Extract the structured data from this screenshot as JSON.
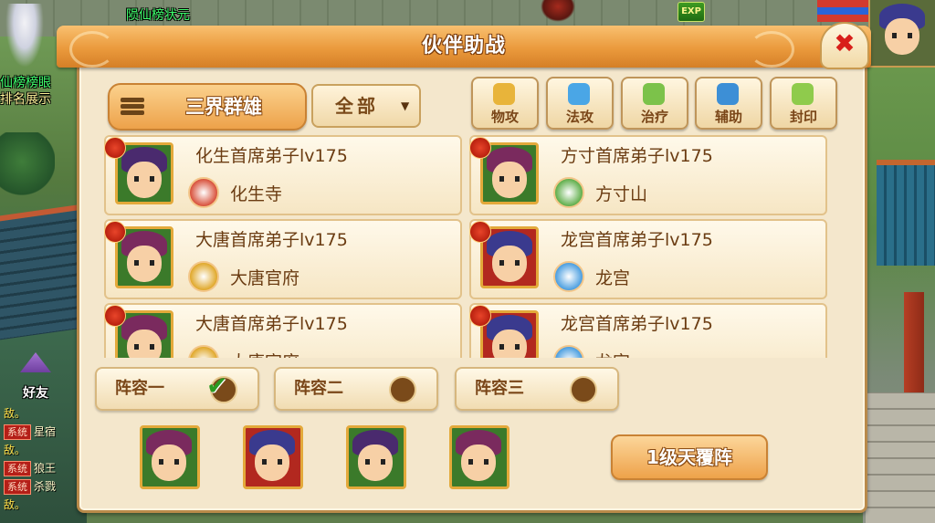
{
  "scene": {
    "top_name": "陨仙榜状元",
    "left_label_1": "仙榜榜眼",
    "left_label_2": "排名展示",
    "exp_label": "EXP",
    "friend_label": "好友",
    "chat": [
      {
        "prefix": "敌。",
        "system": "",
        "text": ""
      },
      {
        "prefix": "",
        "system": "系统",
        "text": "星宿"
      },
      {
        "prefix": "敌。",
        "system": "",
        "text": ""
      },
      {
        "prefix": "",
        "system": "系统",
        "text": "狼王"
      },
      {
        "prefix": "",
        "system": "系统",
        "text": "杀戮"
      },
      {
        "prefix": "敌。",
        "system": "",
        "text": ""
      }
    ]
  },
  "panel": {
    "title": "伙伴助战",
    "close_label": "✖",
    "filter_label": "三界群雄",
    "dropdown_label": "全部",
    "dropdown_arrow": "▼",
    "roles": [
      {
        "label": "物攻",
        "icon": "sword-icon",
        "color": "#e8b43a"
      },
      {
        "label": "法攻",
        "icon": "crystal-icon",
        "color": "#4aa6e6"
      },
      {
        "label": "治疗",
        "icon": "leaf-icon",
        "color": "#7cc24a"
      },
      {
        "label": "辅助",
        "icon": "book-icon",
        "color": "#3d8fd6"
      },
      {
        "label": "封印",
        "icon": "seal-icon",
        "color": "#8fcb4c"
      }
    ],
    "partners": [
      {
        "name": "化生首席弟子lv175",
        "sect": "化生寺",
        "sect_color": "#d8503a",
        "hair": "#4a2a6e",
        "background": "#3b7a2a"
      },
      {
        "name": "方寸首席弟子lv175",
        "sect": "方寸山",
        "sect_color": "#5fae4a",
        "hair": "#7a2a5e",
        "background": "#3b7a2a"
      },
      {
        "name": "大唐首席弟子lv175",
        "sect": "大唐官府",
        "sect_color": "#e0a82a",
        "hair": "#7a2a5e",
        "background": "#3b7a2a"
      },
      {
        "name": "龙宫首席弟子lv175",
        "sect": "龙宫",
        "sect_color": "#4a9ee0",
        "hair": "#3a3a8e",
        "background": "#b2281f"
      },
      {
        "name": "大唐首席弟子lv175",
        "sect": "大唐官府",
        "sect_color": "#e0a82a",
        "hair": "#7a2a5e",
        "background": "#3b7a2a"
      },
      {
        "name": "龙宫首席弟子lv175",
        "sect": "龙宫",
        "sect_color": "#4a9ee0",
        "hair": "#3a3a8e",
        "background": "#b2281f"
      }
    ],
    "lineups": [
      {
        "label": "阵容一",
        "selected": true
      },
      {
        "label": "阵容二",
        "selected": false
      },
      {
        "label": "阵容三",
        "selected": false
      }
    ],
    "slots": [
      {
        "hair": "#7a2a5e",
        "background": "#3b7a2a"
      },
      {
        "hair": "#3a3a8e",
        "background": "#b2281f"
      },
      {
        "hair": "#4a2a6e",
        "background": "#3b7a2a"
      },
      {
        "hair": "#7a2a5e",
        "background": "#3b7a2a"
      }
    ],
    "formation_label": "1级天覆阵"
  }
}
